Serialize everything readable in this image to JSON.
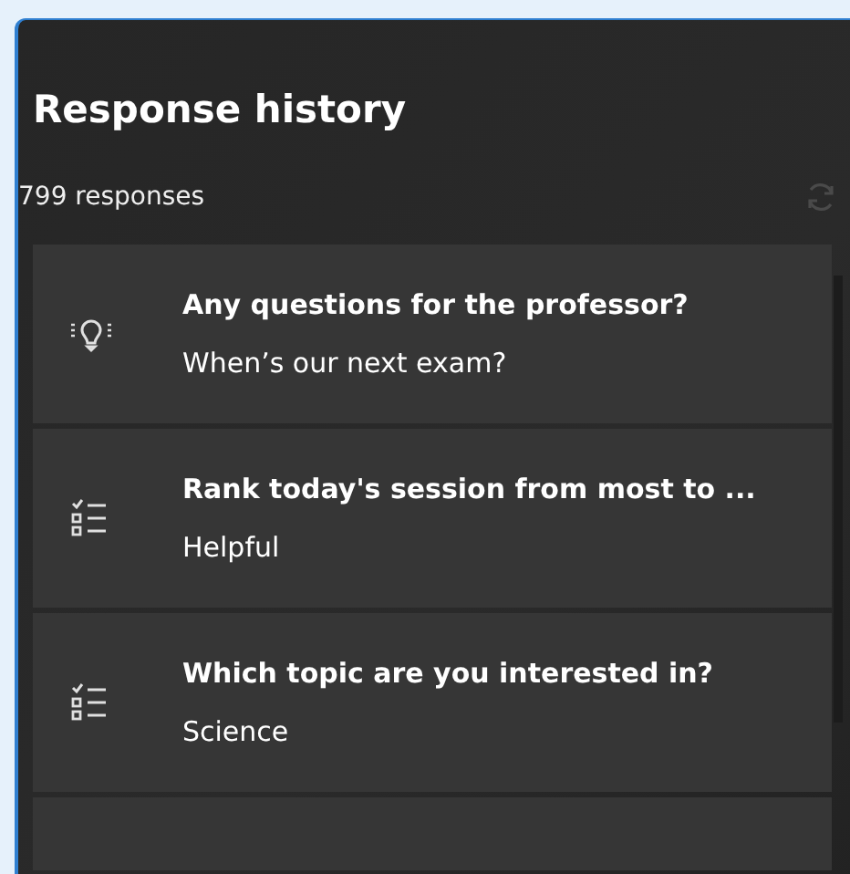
{
  "panel": {
    "title": "Response history",
    "count": "799 responses"
  },
  "responses": [
    {
      "kind": "idea",
      "question": "Any questions for the professor?",
      "answer": "When’s our next exam?"
    },
    {
      "kind": "list",
      "question": "Rank today's session from most to ...",
      "answer": "Helpful"
    },
    {
      "kind": "list",
      "question": "Which topic are you interested in?",
      "answer": "Science"
    },
    {
      "kind": "empty"
    }
  ]
}
